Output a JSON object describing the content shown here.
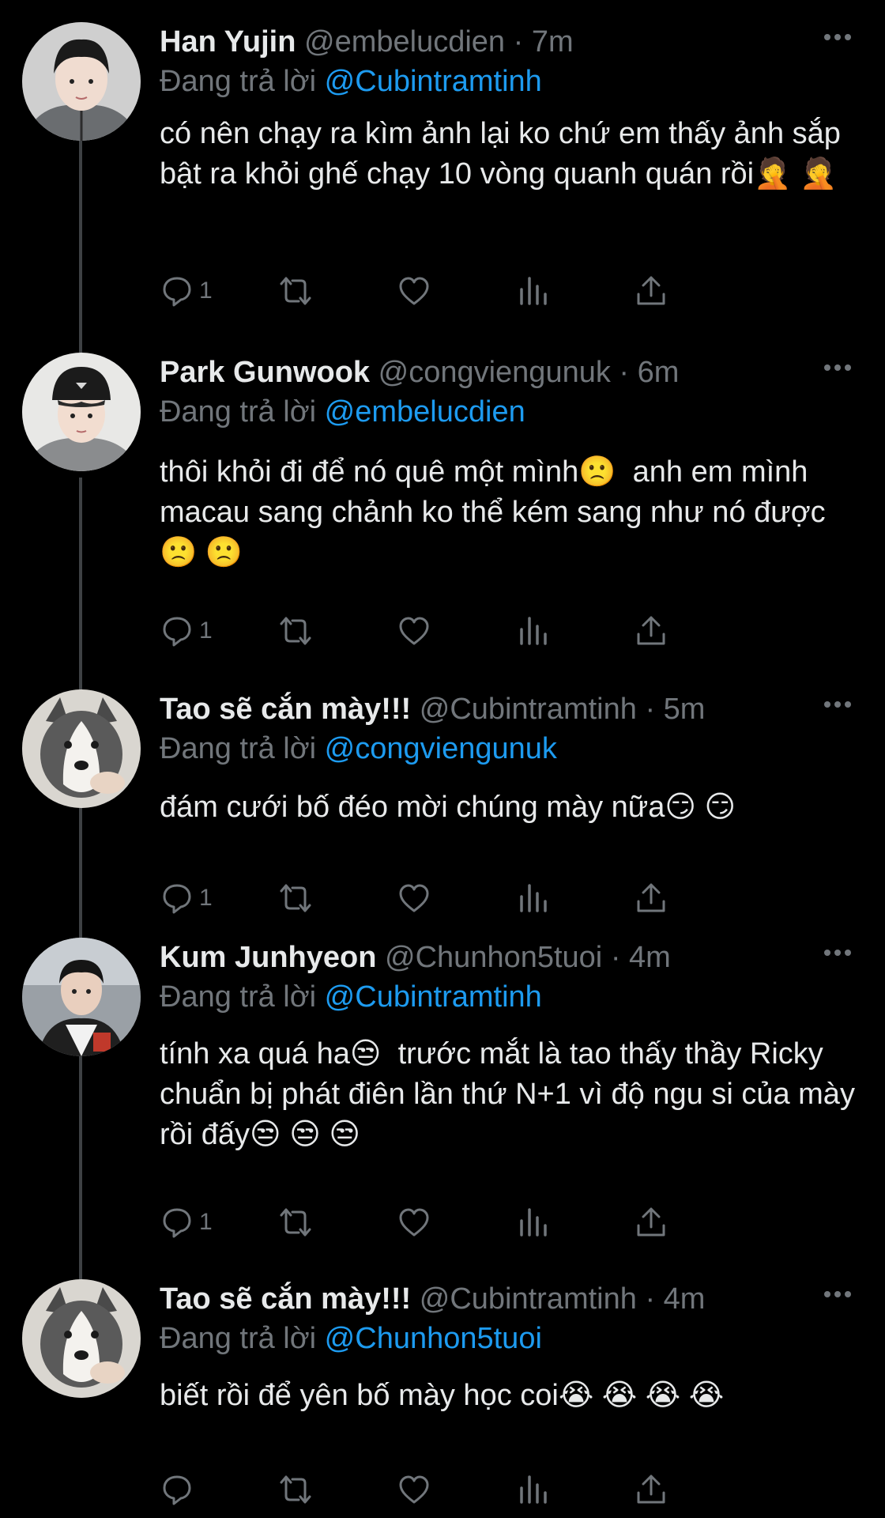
{
  "thread": {
    "tweets": [
      {
        "display_name": "Han Yujin",
        "handle": "@embelucdien",
        "separator": "·",
        "time": "7m",
        "reply_prefix": "Đang trả lời",
        "reply_to": "@Cubintramtinh",
        "text": "có nên chạy ra kìm ảnh lại ko chứ em thấy ảnh sắp bật ra khỏi ghế chạy 10 vòng quanh quán rồi🤦 🤦",
        "reply_count": "1",
        "avatar": "avatar-boy-gray-hoodie"
      },
      {
        "display_name": "Park Gunwook",
        "handle": "@congviengunuk",
        "separator": "·",
        "time": "6m",
        "reply_prefix": "Đang trả lời",
        "reply_to": "@embelucdien",
        "text": "thôi khỏi đi để nó quê một mình🙁  anh em mình macau sang chảnh ko thể kém sang như nó được🙁 🙁",
        "reply_count": "1",
        "avatar": "avatar-boy-black-cap"
      },
      {
        "display_name": "Tao sẽ cắn mày!!!",
        "handle": "@Cubintramtinh",
        "separator": "·",
        "time": "5m",
        "reply_prefix": "Đang trả lời",
        "reply_to": "@congviengunuk",
        "text": "đám cưới bố đéo mời chúng mày nữa😏 😏",
        "reply_count": "1",
        "avatar": "avatar-husky-dog"
      },
      {
        "display_name": "Kum Junhyeon",
        "handle": "@Chunhon5tuoi",
        "separator": "·",
        "time": "4m",
        "reply_prefix": "Đang trả lời",
        "reply_to": "@Cubintramtinh",
        "text": "tính xa quá ha😒  trước mắt là tao thấy thầy Ricky chuẩn bị phát điên lần thứ N+1 vì độ ngu si của mày rồi đấy😒 😒 😒",
        "reply_count": "1",
        "avatar": "avatar-boy-varsity-jacket"
      },
      {
        "display_name": "Tao sẽ cắn mày!!!",
        "handle": "@Cubintramtinh",
        "separator": "·",
        "time": "4m",
        "reply_prefix": "Đang trả lời",
        "reply_to": "@Chunhon5tuoi",
        "text": "biết rồi để yên bố mày học coi😭 😭 😭 😭",
        "reply_count": "",
        "avatar": "avatar-husky-dog"
      }
    ],
    "icons": {
      "reply": "reply-bubble-icon",
      "retweet": "retweet-icon",
      "like": "heart-icon",
      "analytics": "analytics-bars-icon",
      "share": "share-upload-icon",
      "more": "more-dots-icon"
    },
    "colors": {
      "background": "#000000",
      "text": "#e7e9ea",
      "muted": "#71767b",
      "link": "#1d9bf0",
      "thread_line": "#3e4144"
    }
  }
}
